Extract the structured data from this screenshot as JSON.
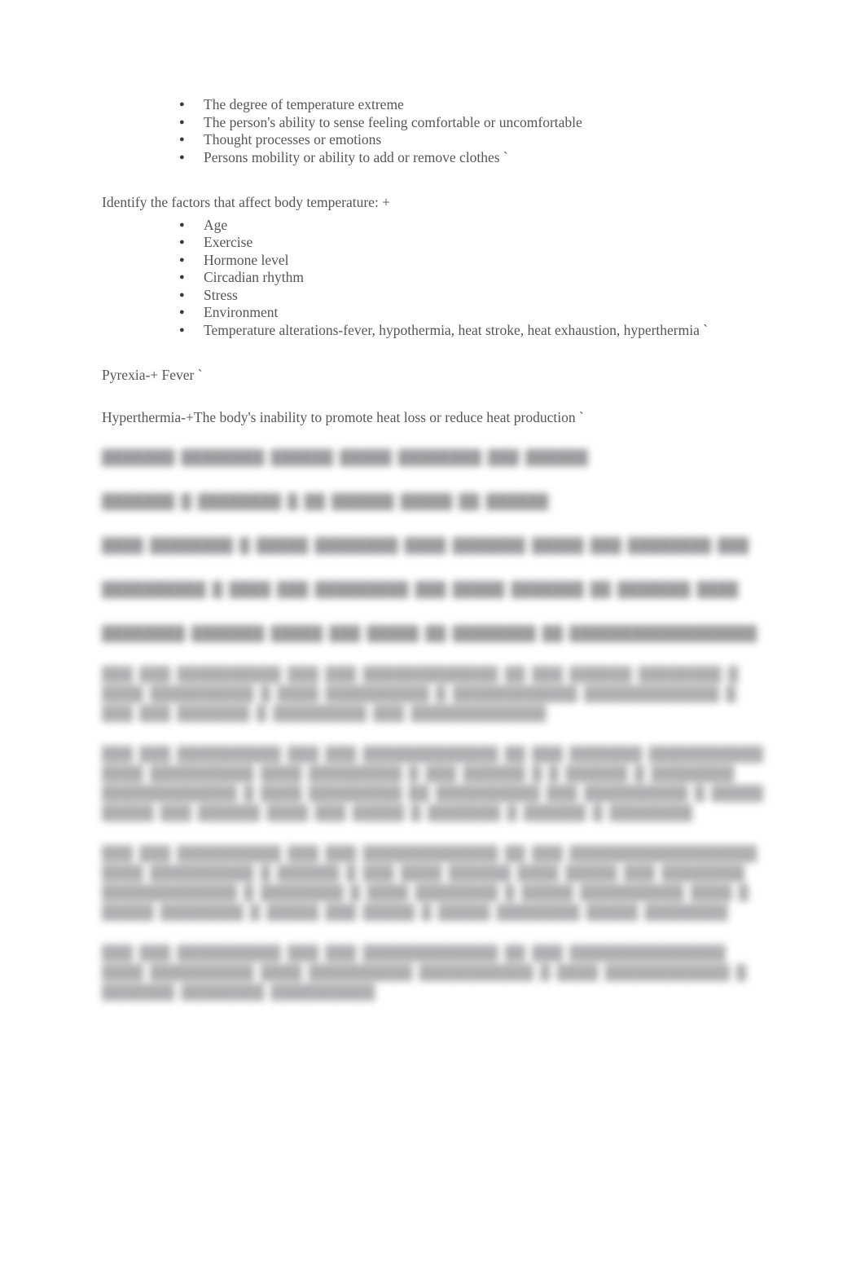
{
  "document": {
    "page_background": "#ffffff",
    "text_color": "#55555a",
    "bullet_glyph": "●"
  },
  "section_comfort": {
    "bullets": [
      "The degree of temperature extreme",
      "The person's ability to sense feeling comfortable or uncomfortable",
      "Thought processes or emotions",
      "Persons mobility or ability to add or remove clothes `"
    ]
  },
  "section_factors": {
    "heading": "Identify the factors that affect body temperature: +",
    "bullets": [
      "Age",
      "Exercise",
      "Hormone level",
      "Circadian rhythm",
      "Stress",
      "Environment",
      "Temperature alterations-fever, hypothermia, heat stroke, heat exhaustion, hyperthermia `"
    ]
  },
  "definitions": [
    "Pyrexia-+ Fever `",
    "Hyperthermia-+The body's inability to promote heat loss or reduce heat production `"
  ],
  "redacted": {
    "note": "Remaining paragraphs are blurred in the source image and not legible.",
    "single_lines": [
      "███████ ████████ ██████ █████ ████████ ███ ██████",
      "███████ █ ████████ █ ██ ██████ █████ ██ ██████",
      "████ ████████ █ █████ ████████ ████ ███████ █████ ███ ████████ ███",
      "██████████ █ ████ ███ █████████ ███ █████ ███████ ██ ███████ ████",
      "████████ ███████ █████ ███ █████ ██ ████████ ██ ██████████████████"
    ],
    "paragraphs": [
      "███ ███ ██████████ ███ ███ █████████████ ██ ███ ██████ ████████ █ ████ ██████████ █ ████ ██████████ █ ████████████ █████████████ █ ███ ███ ███████ █ █████████ ███ █████████████",
      "███ ███ ██████████ ███ ███ █████████████ ██ ███ ███████ ███████████ ████ ██████████ ████ █████████ █ ███ ██████ █ █ ██████ █ ████████ █████████████ █ ████ █████████ ██ ██████████ ███ ██████████ █ █████ █████ ███ ██████ ████ ███ █████ █ ███████ █ ██████ █ ████████",
      "███ ███ ██████████ ███ ███ █████████████ ██ ███ ██████████████████ ████ ██████████ █ ██████ █ ███ ████ ██████ ████ █████ ███ ████████ █████████████ █ ████████ █ ████ ████████ █ █████ ██████████ ████ █ █████ ████████ █ █████ ███ █████ █ █████ ████████ █████ ████████",
      "███ ███ ██████████ ███ ███ █████████████ ██ ███ ███████████████ ████ ██████████ ████ ██████████ ███████████ █ ████ ████████████ █ ███████ ████████ ██████████"
    ]
  }
}
